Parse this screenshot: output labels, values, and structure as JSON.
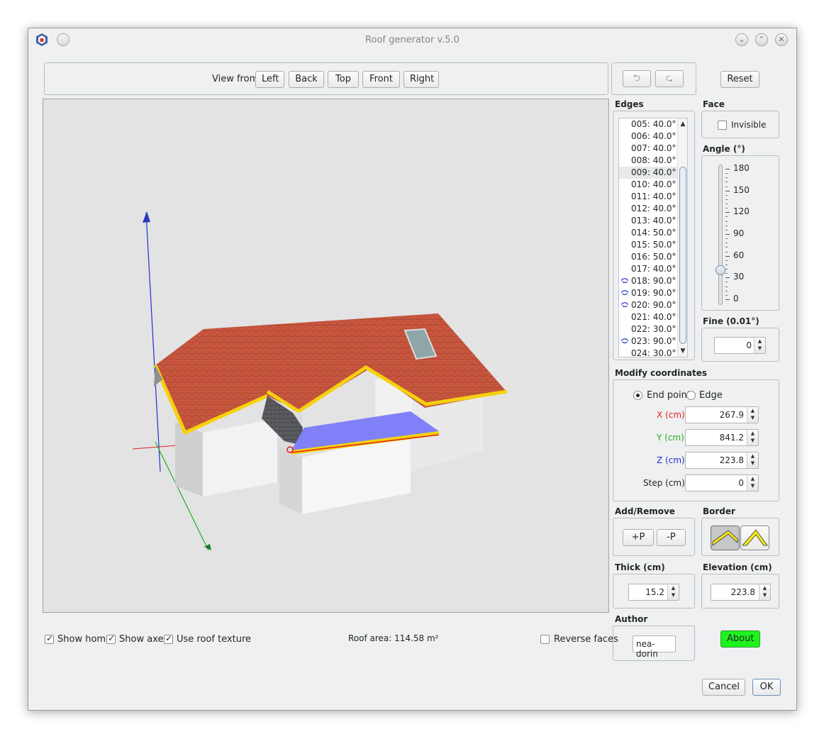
{
  "window": {
    "title": "Roof generator v.5.0"
  },
  "view_bar": {
    "label": "View from",
    "buttons": [
      "Left",
      "Back",
      "Top",
      "Front",
      "Right"
    ]
  },
  "undo_redo": {
    "undo_icon": "undo-arrow-icon",
    "redo_icon": "redo-arrow-icon"
  },
  "reset_label": "Reset",
  "edges": {
    "title": "Edges",
    "items": [
      {
        "label": "005: 40.0°",
        "hidden": false
      },
      {
        "label": "006: 40.0°",
        "hidden": false
      },
      {
        "label": "007: 40.0°",
        "hidden": false
      },
      {
        "label": "008: 40.0°",
        "hidden": false
      },
      {
        "label": "009: 40.0°",
        "hidden": false
      },
      {
        "label": "010: 40.0°",
        "hidden": false
      },
      {
        "label": "011: 40.0°",
        "hidden": false
      },
      {
        "label": "012: 40.0°",
        "hidden": false
      },
      {
        "label": "013: 40.0°",
        "hidden": false
      },
      {
        "label": "014: 50.0°",
        "hidden": false
      },
      {
        "label": "015: 50.0°",
        "hidden": false
      },
      {
        "label": "016: 50.0°",
        "hidden": false
      },
      {
        "label": "017: 40.0°",
        "hidden": false
      },
      {
        "label": "018: 90.0°",
        "hidden": true
      },
      {
        "label": "019: 90.0°",
        "hidden": true
      },
      {
        "label": "020: 90.0°",
        "hidden": true
      },
      {
        "label": "021: 40.0°",
        "hidden": false
      },
      {
        "label": "022: 30.0°",
        "hidden": false
      },
      {
        "label": "023: 90.0°",
        "hidden": true
      },
      {
        "label": "024: 30.0°",
        "hidden": false
      }
    ],
    "selected_index": 4
  },
  "face": {
    "title": "Face",
    "invisible_label": "Invisible",
    "invisible_checked": false
  },
  "angle": {
    "title": "Angle (°)",
    "ticks": [
      "180",
      "150",
      "120",
      "90",
      "60",
      "30",
      "0"
    ],
    "value": 40,
    "max": 180
  },
  "fine": {
    "title": "Fine (0.01°)",
    "value": "0"
  },
  "coords": {
    "title": "Modify coordinates",
    "mode_end_point": "End point",
    "mode_edge": "Edge",
    "x_label": "X (cm):",
    "x_value": "267.9",
    "x_color": "#e0201b",
    "y_label": "Y (cm):",
    "y_value": "841.2",
    "y_color": "#22b01f",
    "z_label": "Z (cm):",
    "z_value": "223.8",
    "z_color": "#2130d2",
    "step_label": "Step (cm):",
    "step_value": "0"
  },
  "add_remove": {
    "title": "Add/Remove",
    "add_label": "+P",
    "remove_label": "-P"
  },
  "border": {
    "title": "Border"
  },
  "thick": {
    "title": "Thick (cm)",
    "value": "15.2"
  },
  "elevation": {
    "title": "Elevation (cm)",
    "value": "223.8"
  },
  "author": {
    "title": "Author",
    "value": "nea-dorin"
  },
  "about_label": "About",
  "about_color": "#1ef21e",
  "bottom": {
    "show_home": "Show home",
    "show_axes": "Show axes",
    "use_roof_texture": "Use roof texture",
    "roof_area_label": "Roof area: 114.58 m²",
    "reverse_faces": "Reverse faces"
  },
  "cancel_label": "Cancel",
  "ok_label": "OK"
}
